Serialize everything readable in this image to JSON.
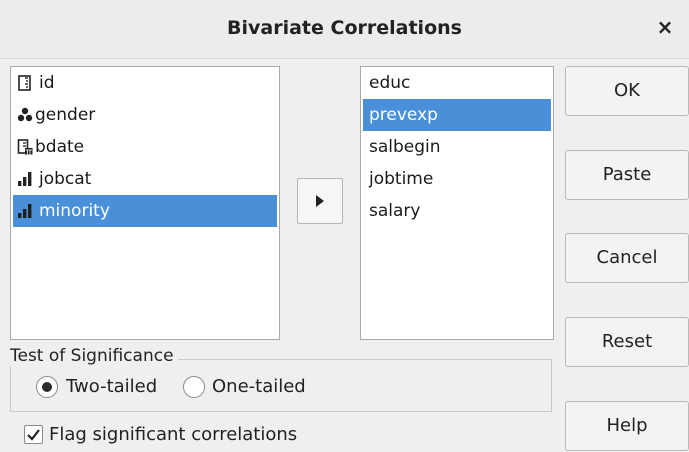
{
  "dialog": {
    "title": "Bivariate Correlations",
    "close_glyph": "×"
  },
  "source_list": {
    "items": [
      {
        "label": "id",
        "icon": "scale-ruler-icon"
      },
      {
        "label": "gender",
        "icon": "nominal-icon"
      },
      {
        "label": "bdate",
        "icon": "date-icon"
      },
      {
        "label": "jobcat",
        "icon": "ordinal-bars-icon"
      },
      {
        "label": "minority",
        "icon": "ordinal-bars-icon",
        "selected": true
      }
    ]
  },
  "target_list": {
    "items": [
      {
        "label": "educ"
      },
      {
        "label": "prevexp",
        "selected": true
      },
      {
        "label": "salbegin"
      },
      {
        "label": "jobtime"
      },
      {
        "label": "salary"
      }
    ]
  },
  "buttons": {
    "ok": "OK",
    "paste": "Paste",
    "cancel": "Cancel",
    "reset": "Reset",
    "help": "Help"
  },
  "significance": {
    "group_label": "Test of Significance",
    "two_tailed": "Two-tailed",
    "one_tailed": "One-tailed",
    "selected": "Two-tailed"
  },
  "flag": {
    "label": "Flag significant correlations",
    "checked": true
  },
  "colors": {
    "selection": "#4a90d9",
    "dialog_bg": "#efefef"
  }
}
